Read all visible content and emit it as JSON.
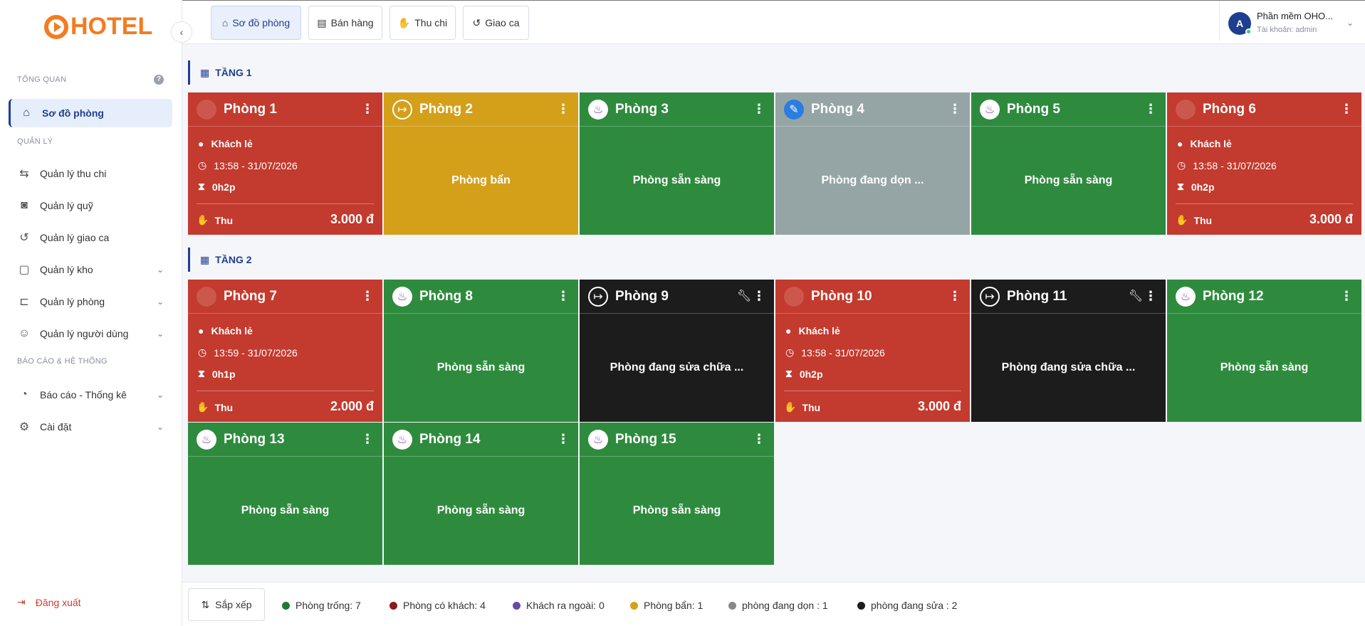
{
  "app": {
    "logo_text": "HOTEL",
    "colors": {
      "accent": "#1d3f8f",
      "logo": "#f47b20"
    }
  },
  "sidebar": {
    "section_overview": "TỔNG QUAN",
    "section_manage": "QUẢN LÝ",
    "section_report": "BÁO CÁO & HỆ THỐNG",
    "items": [
      {
        "label": "Sơ đồ phòng",
        "icon": "home-icon"
      },
      {
        "label": "Quản lý thu chi",
        "icon": "transfer-icon"
      },
      {
        "label": "Quản lý quỹ",
        "icon": "safe-icon"
      },
      {
        "label": "Quản lý giao ca",
        "icon": "history-icon"
      },
      {
        "label": "Quản lý kho",
        "icon": "box-icon"
      },
      {
        "label": "Quản lý phòng",
        "icon": "bed-icon"
      },
      {
        "label": "Quản lý người dùng",
        "icon": "users-icon"
      },
      {
        "label": "Báo cáo - Thống kê",
        "icon": "chart-icon"
      },
      {
        "label": "Cài đặt",
        "icon": "gear-icon"
      }
    ],
    "logout": "Đăng xuất"
  },
  "topbar": {
    "tabs": [
      {
        "label": "Sơ đồ phòng",
        "icon": "home-icon"
      },
      {
        "label": "Bán hàng",
        "icon": "cash-register-icon"
      },
      {
        "label": "Thu chi",
        "icon": "hand-money-icon"
      },
      {
        "label": "Giao ca",
        "icon": "history-icon"
      }
    ],
    "user": {
      "initial": "A",
      "name": "Phần mềm OHO...",
      "account": "Tài khoản: admin"
    }
  },
  "floors": [
    {
      "name": "TẦNG 1"
    },
    {
      "name": "TẦNG 2"
    }
  ],
  "rooms": [
    {
      "name": "Phòng 1",
      "state": "occupied",
      "guest": "Khách lẻ",
      "time": "13:58 - 31/07/2026",
      "duration": "0h2p",
      "thu_label": "Thu",
      "amount": "3.000 đ"
    },
    {
      "name": "Phòng 2",
      "state": "dirty",
      "status": "Phòng bẩn"
    },
    {
      "name": "Phòng 3",
      "state": "ready",
      "status": "Phòng sẵn sàng"
    },
    {
      "name": "Phòng 4",
      "state": "cleaning",
      "status": "Phòng đang dọn ..."
    },
    {
      "name": "Phòng 5",
      "state": "ready",
      "status": "Phòng sẵn sàng"
    },
    {
      "name": "Phòng 6",
      "state": "occupied",
      "guest": "Khách lẻ",
      "time": "13:58 - 31/07/2026",
      "duration": "0h2p",
      "thu_label": "Thu",
      "amount": "3.000 đ"
    },
    {
      "name": "Phòng 7",
      "state": "occupied",
      "guest": "Khách lẻ",
      "time": "13:59 - 31/07/2026",
      "duration": "0h1p",
      "thu_label": "Thu",
      "amount": "2.000 đ"
    },
    {
      "name": "Phòng 8",
      "state": "ready",
      "status": "Phòng sẵn sàng"
    },
    {
      "name": "Phòng 9",
      "state": "repair",
      "status": "Phòng đang sửa chữa ..."
    },
    {
      "name": "Phòng 10",
      "state": "occupied",
      "guest": "Khách lẻ",
      "time": "13:58 - 31/07/2026",
      "duration": "0h2p",
      "thu_label": "Thu",
      "amount": "3.000 đ"
    },
    {
      "name": "Phòng 11",
      "state": "repair",
      "status": "Phòng đang sửa chữa ..."
    },
    {
      "name": "Phòng 12",
      "state": "ready",
      "status": "Phòng sẵn sàng"
    },
    {
      "name": "Phòng 13",
      "state": "ready",
      "status": "Phòng sẵn sàng"
    },
    {
      "name": "Phòng 14",
      "state": "ready",
      "status": "Phòng sẵn sàng"
    },
    {
      "name": "Phòng 15",
      "state": "ready",
      "status": "Phòng sẵn sàng"
    }
  ],
  "bottombar": {
    "sort_label": "Sắp xếp",
    "legend": [
      {
        "label": "Phòng trống: 7",
        "color": "#1e7a34"
      },
      {
        "label": "Phòng có khách: 4",
        "color": "#8b1a1a"
      },
      {
        "label": "Khách ra ngoài: 0",
        "color": "#6a4aa8"
      },
      {
        "label": "Phòng bẩn: 1",
        "color": "#d4a01a"
      },
      {
        "label": "phòng đang dọn : 1",
        "color": "#888888"
      },
      {
        "label": "phòng đang sửa : 2",
        "color": "#1c1c1c"
      }
    ]
  }
}
